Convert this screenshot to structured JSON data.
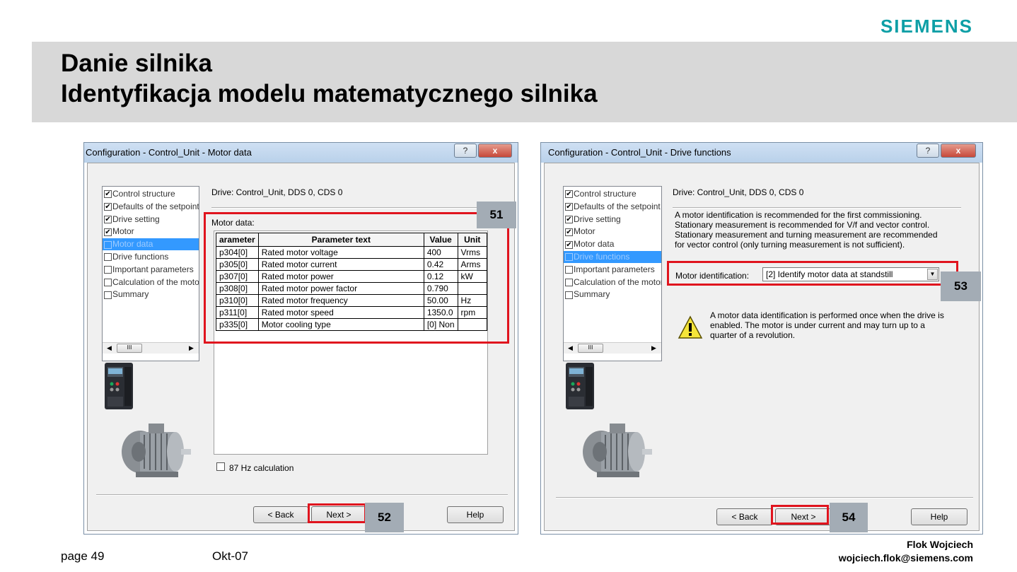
{
  "brand": {
    "logo": "SIEMENS",
    "color": "#0e9fa6"
  },
  "slide": {
    "title1": "Danie silnika",
    "title2": "Identyfikacja modelu matematycznego silnika"
  },
  "tree_items": [
    {
      "label": "Control structure",
      "checked": true
    },
    {
      "label": "Defaults of the setpoint",
      "checked": true
    },
    {
      "label": "Drive setting",
      "checked": true
    },
    {
      "label": "Motor",
      "checked": true
    },
    {
      "label": "Motor data",
      "checked": false
    },
    {
      "label": "Drive functions",
      "checked": false
    },
    {
      "label": "Important parameters",
      "checked": false
    },
    {
      "label": "Calculation of the motor",
      "checked": false
    },
    {
      "label": "Summary",
      "checked": false
    }
  ],
  "left": {
    "title": "Configuration - Control_Unit - Motor data",
    "drive": "Drive: Control_Unit, DDS 0, CDS 0",
    "motor_data_label": "Motor data:",
    "columns": [
      "arameter",
      "Parameter text",
      "Value",
      "Unit"
    ],
    "rows": [
      [
        "p304[0]",
        "Rated motor voltage",
        "400",
        "Vrms"
      ],
      [
        "p305[0]",
        "Rated motor current",
        "0.42",
        "Arms"
      ],
      [
        "p307[0]",
        "Rated motor power",
        "0.12",
        "kW"
      ],
      [
        "p308[0]",
        "Rated motor power factor",
        "0.790",
        ""
      ],
      [
        "p310[0]",
        "Rated motor frequency",
        "50.00",
        "Hz"
      ],
      [
        "p311[0]",
        "Rated motor speed",
        "1350.0",
        "rpm"
      ],
      [
        "p335[0]",
        "Motor cooling type",
        "[0] Non",
        ""
      ]
    ],
    "calc87": "87 Hz calculation",
    "back": "< Back",
    "next": "Next >",
    "help": "Help",
    "tag_table": "51",
    "tag_next": "52"
  },
  "right": {
    "title": "Configuration - Control_Unit - Drive functions",
    "drive": "Drive: Control_Unit, DDS 0, CDS 0",
    "info": [
      "A motor identification is recommended for the first commissioning.",
      "Stationary measurement is recommended for V/f and vector control.",
      "Stationary measurement and turning measurement are recommended",
      "for vector control (only turning measurement is not sufficient)."
    ],
    "motor_id_label": "Motor identification:",
    "motor_id_value": "[2] Identify motor data at standstill",
    "warning": [
      "A motor data identification is performed once when the drive is",
      "enabled. The motor is under current and may turn up to a",
      "quarter of a revolution."
    ],
    "back": "< Back",
    "next": "Next >",
    "help": "Help",
    "tag_combo": "53",
    "tag_next": "54"
  },
  "window_buttons": {
    "help": "?",
    "close": "x"
  },
  "scroll_thumb": "III",
  "footer": {
    "page": "page 49",
    "date": "Okt-07",
    "author": "Flok Wojciech",
    "email": "wojciech.flok@siemens.com"
  }
}
